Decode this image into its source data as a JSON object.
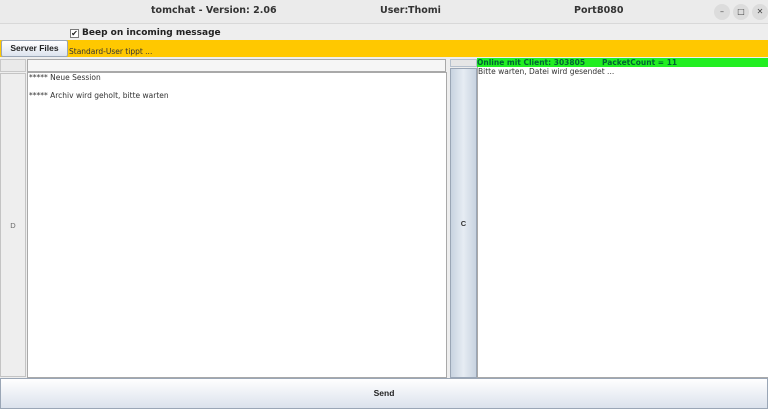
{
  "window": {
    "app_title": "tomchat - Version: 2.06",
    "user_label": "User:",
    "user_value": "Thomi",
    "port_label": "Port:",
    "port_value": "8080",
    "minimize_glyph": "–",
    "maximize_glyph": "□",
    "close_glyph": "✕"
  },
  "options": {
    "beep_label": "Beep on incoming message",
    "beep_checked": true,
    "check_glyph": "✔"
  },
  "toolbar": {
    "server_files_label": "Server Files",
    "typing_status": "Standard-User tippt ..."
  },
  "left_panel": {
    "side_button_label": "D",
    "input_value": "",
    "log_lines": [
      "***** Neue Session",
      "***** Archiv wird geholt, bitte warten"
    ]
  },
  "right_panel": {
    "side_button_label": "C",
    "online_text": "Online mit Client: 303805",
    "packet_count_text": "PacketCount = 11",
    "status_color": "#22ee22",
    "log_lines": [
      "Bitte warten, Datei wird gesendet ..."
    ]
  },
  "footer": {
    "send_label": "Send"
  },
  "colors": {
    "typing_strip": "#ffc800",
    "online_bar": "#22ee22"
  }
}
